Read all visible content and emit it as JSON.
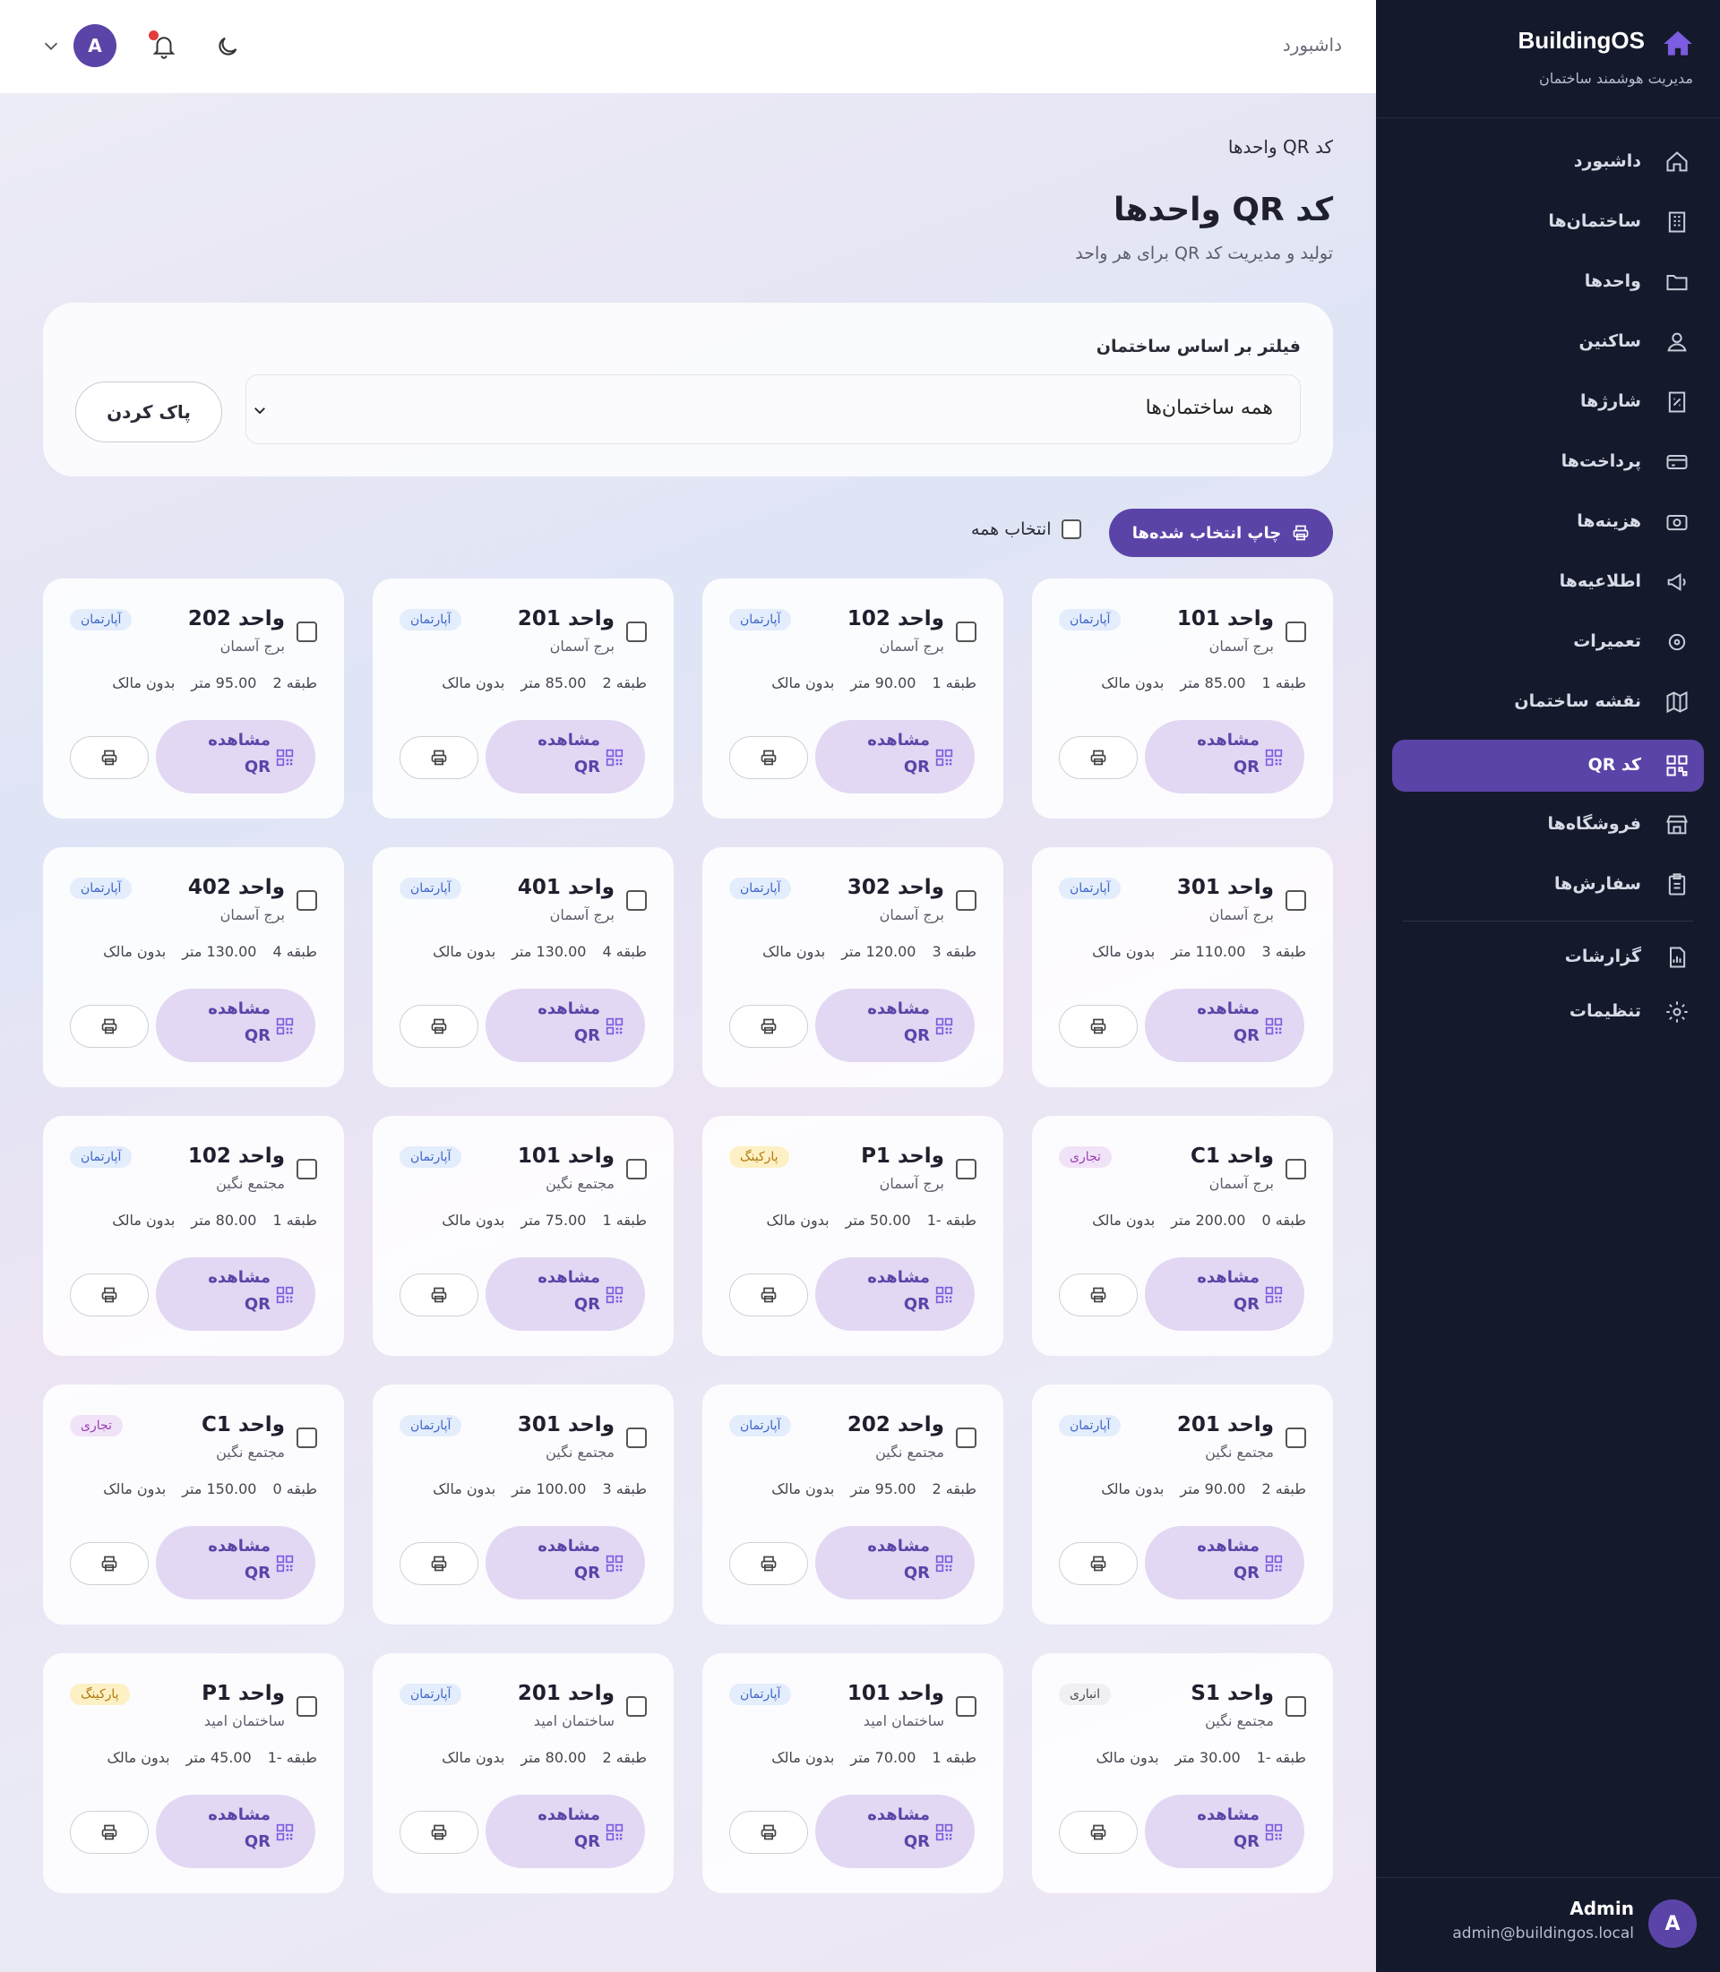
{
  "header": {
    "breadcrumb_home": "داشبورد",
    "avatar_letter": "A"
  },
  "page": {
    "breadcrumb": "کد QR واحدها",
    "title": "کد QR واحدها",
    "subtitle": "تولید و مدیریت کد QR برای هر واحد"
  },
  "filter": {
    "label": "فیلتر بر اساس ساختمان",
    "selected": "همه ساختمان‌ها",
    "clear_label": "پاک کردن"
  },
  "actions": {
    "print_selected": "چاپ انتخاب شده‌ها",
    "select_all": "انتخاب همه"
  },
  "card_labels": {
    "view_l1": "مشاهده",
    "view_l2": "QR"
  },
  "units": [
    {
      "title": "واحد 101",
      "building": "برج آسمان",
      "badge": "آپارتمان",
      "badge_type": "apt",
      "floor": "طبقه 1",
      "area": "85.00 متر",
      "owner": "بدون مالک"
    },
    {
      "title": "واحد 102",
      "building": "برج آسمان",
      "badge": "آپارتمان",
      "badge_type": "apt",
      "floor": "طبقه 1",
      "area": "90.00 متر",
      "owner": "بدون مالک"
    },
    {
      "title": "واحد 201",
      "building": "برج آسمان",
      "badge": "آپارتمان",
      "badge_type": "apt",
      "floor": "طبقه 2",
      "area": "85.00 متر",
      "owner": "بدون مالک"
    },
    {
      "title": "واحد 202",
      "building": "برج آسمان",
      "badge": "آپارتمان",
      "badge_type": "apt",
      "floor": "طبقه 2",
      "area": "95.00 متر",
      "owner": "بدون مالک"
    },
    {
      "title": "واحد 301",
      "building": "برج آسمان",
      "badge": "آپارتمان",
      "badge_type": "apt",
      "floor": "طبقه 3",
      "area": "110.00 متر",
      "owner": "بدون مالک"
    },
    {
      "title": "واحد 302",
      "building": "برج آسمان",
      "badge": "آپارتمان",
      "badge_type": "apt",
      "floor": "طبقه 3",
      "area": "120.00 متر",
      "owner": "بدون مالک"
    },
    {
      "title": "واحد 401",
      "building": "برج آسمان",
      "badge": "آپارتمان",
      "badge_type": "apt",
      "floor": "طبقه 4",
      "area": "130.00 متر",
      "owner": "بدون مالک"
    },
    {
      "title": "واحد 402",
      "building": "برج آسمان",
      "badge": "آپارتمان",
      "badge_type": "apt",
      "floor": "طبقه 4",
      "area": "130.00 متر",
      "owner": "بدون مالک"
    },
    {
      "title": "واحد C1",
      "building": "برج آسمان",
      "badge": "تجاری",
      "badge_type": "com",
      "floor": "طبقه 0",
      "area": "200.00 متر",
      "owner": "بدون مالک"
    },
    {
      "title": "واحد P1",
      "building": "برج آسمان",
      "badge": "پارکینگ",
      "badge_type": "park",
      "floor": "طبقه -1",
      "area": "50.00 متر",
      "owner": "بدون مالک"
    },
    {
      "title": "واحد 101",
      "building": "مجتمع نگین",
      "badge": "آپارتمان",
      "badge_type": "apt",
      "floor": "طبقه 1",
      "area": "75.00 متر",
      "owner": "بدون مالک"
    },
    {
      "title": "واحد 102",
      "building": "مجتمع نگین",
      "badge": "آپارتمان",
      "badge_type": "apt",
      "floor": "طبقه 1",
      "area": "80.00 متر",
      "owner": "بدون مالک"
    },
    {
      "title": "واحد 201",
      "building": "مجتمع نگین",
      "badge": "آپارتمان",
      "badge_type": "apt",
      "floor": "طبقه 2",
      "area": "90.00 متر",
      "owner": "بدون مالک"
    },
    {
      "title": "واحد 202",
      "building": "مجتمع نگین",
      "badge": "آپارتمان",
      "badge_type": "apt",
      "floor": "طبقه 2",
      "area": "95.00 متر",
      "owner": "بدون مالک"
    },
    {
      "title": "واحد 301",
      "building": "مجتمع نگین",
      "badge": "آپارتمان",
      "badge_type": "apt",
      "floor": "طبقه 3",
      "area": "100.00 متر",
      "owner": "بدون مالک"
    },
    {
      "title": "واحد C1",
      "building": "مجتمع نگین",
      "badge": "تجاری",
      "badge_type": "com",
      "floor": "طبقه 0",
      "area": "150.00 متر",
      "owner": "بدون مالک"
    },
    {
      "title": "واحد S1",
      "building": "مجتمع نگین",
      "badge": "انباری",
      "badge_type": "store",
      "floor": "طبقه -1",
      "area": "30.00 متر",
      "owner": "بدون مالک"
    },
    {
      "title": "واحد 101",
      "building": "ساختمان امید",
      "badge": "آپارتمان",
      "badge_type": "apt",
      "floor": "طبقه 1",
      "area": "70.00 متر",
      "owner": "بدون مالک"
    },
    {
      "title": "واحد 201",
      "building": "ساختمان امید",
      "badge": "آپارتمان",
      "badge_type": "apt",
      "floor": "طبقه 2",
      "area": "80.00 متر",
      "owner": "بدون مالک"
    },
    {
      "title": "واحد P1",
      "building": "ساختمان امید",
      "badge": "پارکینگ",
      "badge_type": "park",
      "floor": "طبقه -1",
      "area": "45.00 متر",
      "owner": "بدون مالک"
    }
  ],
  "sidebar": {
    "brand": "BuildingOS",
    "brand_sub": "مدیریت هوشمند ساختمان",
    "items": [
      {
        "label": "داشبورد",
        "icon": "home-icon"
      },
      {
        "label": "ساختمان‌ها",
        "icon": "building-icon"
      },
      {
        "label": "واحدها",
        "icon": "folder-icon"
      },
      {
        "label": "ساکنین",
        "icon": "user-icon"
      },
      {
        "label": "شارژها",
        "icon": "receipt-icon"
      },
      {
        "label": "پرداخت‌ها",
        "icon": "credit-card-icon"
      },
      {
        "label": "هزینه‌ها",
        "icon": "wallet-icon"
      },
      {
        "label": "اطلاعیه‌ها",
        "icon": "megaphone-icon"
      },
      {
        "label": "تعمیرات",
        "icon": "wrench-icon"
      },
      {
        "label": "نقشه ساختمان",
        "icon": "map-icon"
      },
      {
        "label": "کد QR",
        "icon": "qr-code-icon"
      },
      {
        "label": "فروشگاه‌ها",
        "icon": "store-icon"
      },
      {
        "label": "سفارش‌ها",
        "icon": "clipboard-icon"
      },
      {
        "label": "گزارشات",
        "icon": "report-icon"
      },
      {
        "label": "تنظیمات",
        "icon": "gear-icon"
      }
    ],
    "user": {
      "name": "Admin",
      "email": "admin@buildingos.local",
      "avatar_letter": "A"
    }
  },
  "colors": {
    "accent": "#5b44a8",
    "sidebar_bg": "#141a2b"
  }
}
